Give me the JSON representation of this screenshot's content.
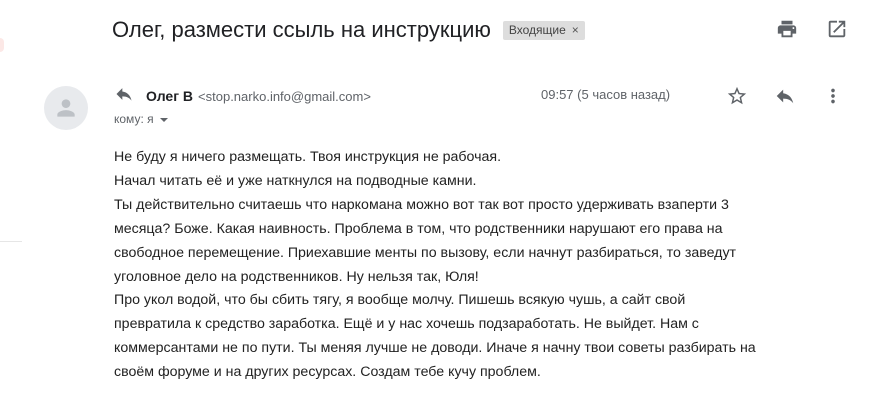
{
  "subject": "Олег, размести ссыль на инструкцию",
  "label_chip": {
    "text": "Входящие",
    "close": "×"
  },
  "toolbar_icons": [
    "print-icon",
    "open-in-new-window-icon"
  ],
  "message": {
    "sender_name": "Олег В",
    "sender_email": "<stop.narko.info@gmail.com>",
    "time": "09:57 (5 часов назад)",
    "to": "кому: я",
    "action_icons": [
      "star-icon",
      "reply-icon",
      "more-vert-icon"
    ],
    "body_lines": [
      "Не буду я ничего размещать. Твоя инструкция не рабочая.",
      "Начал читать её и уже наткнулся на подводные камни.",
      "Ты действительно считаешь что наркомана можно вот так вот просто удерживать взаперти 3",
      "месяца? Боже. Какая наивность. Проблема в том, что родственники нарушают его права на",
      "свободное перемещение. Приехавшие менты по вызову, если начнут разбираться, то заведут",
      "уголовное дело на родственников. Ну нельзя так, Юля!",
      "Про укол водой, что бы сбить тягу,  я вообще молчу. Пишешь всякую чушь, а сайт свой",
      "превратила к средство заработка. Ещё и у нас хочешь подзаработать. Не выйдет. Нам с",
      "коммерсантами не по пути. Ты меняя лучше не доводи. Иначе я начну твои советы разбирать на",
      "своём форуме и на других ресурсах. Создам тебе кучу проблем."
    ]
  }
}
